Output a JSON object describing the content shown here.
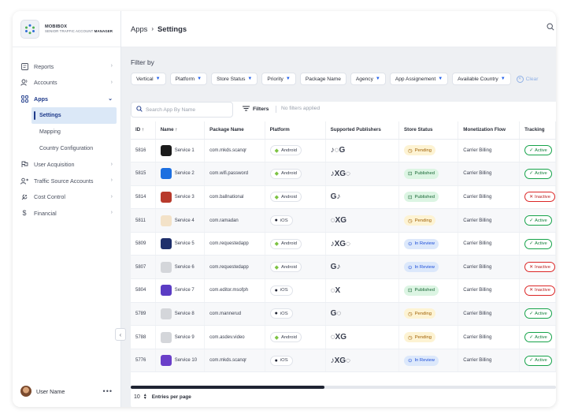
{
  "brand": {
    "name": "MOBIBOX",
    "sub_prefix": "SENIOR TRAFFIC ACCOUNT ",
    "sub_bold": "MANAGER"
  },
  "sidebar": {
    "items": [
      {
        "label": "Reports",
        "icon": "report-icon"
      },
      {
        "label": "Accounts",
        "icon": "users-icon"
      },
      {
        "label": "Apps",
        "icon": "apps-grid-icon"
      },
      {
        "label": "User Acquisition",
        "icon": "acquisition-icon"
      },
      {
        "label": "Traffic Source Accounts",
        "icon": "traffic-icon"
      },
      {
        "label": "Cost Control",
        "icon": "cost-icon"
      },
      {
        "label": "Financial",
        "icon": "dollar-icon"
      }
    ],
    "apps_sub": [
      "Settings",
      "Mapping",
      "Country Configuration"
    ],
    "user": {
      "name": "User Name"
    }
  },
  "breadcrumb": {
    "parent": "Apps",
    "current": "Settings"
  },
  "filter": {
    "title": "Filter by",
    "chips": [
      "Vertical",
      "Platform",
      "Store Status",
      "Priority",
      "Package Name",
      "Agency",
      "App Assignement",
      "Available Country"
    ],
    "clear": "Clear"
  },
  "toolbar": {
    "search_placeholder": "Search App By Name",
    "filters_label": "Filters",
    "no_filters": "No filters applied"
  },
  "table": {
    "columns": [
      "ID",
      "Name",
      "Package Name",
      "Platform",
      "Supported Publishers",
      "Store Status",
      "Monetization Flow",
      "Tracking"
    ],
    "rows": [
      {
        "id": "5816",
        "name": "Service 1",
        "package": "com.mkds.scanqr",
        "platform": "Android",
        "pubs": "♪◌G",
        "status": "Pending",
        "flow": "Carrier Billing",
        "tracking": "Active",
        "icon_color": "#1b1b1b"
      },
      {
        "id": "5815",
        "name": "Service 2",
        "package": "com.wifi.password",
        "platform": "Android",
        "pubs": "♪XG◌",
        "status": "Published",
        "flow": "Carrier Billing",
        "tracking": "Active",
        "icon_color": "#1d6fe0"
      },
      {
        "id": "5814",
        "name": "Service 3",
        "package": "com.ballnational",
        "platform": "Android",
        "pubs": "G♪",
        "status": "Published",
        "flow": "Carrier Billing",
        "tracking": "Inactive",
        "icon_color": "#b83a2c"
      },
      {
        "id": "5811",
        "name": "Service 4",
        "package": "com.ramadan",
        "platform": "iOS",
        "pubs": "◌XG",
        "status": "Pending",
        "flow": "Carrier Billing",
        "tracking": "Active",
        "icon_color": "#f3e2c8"
      },
      {
        "id": "5809",
        "name": "Service 5",
        "package": "com.requestedapp",
        "platform": "Android",
        "pubs": "♪XG◌",
        "status": "In Review",
        "flow": "Carrier Billing",
        "tracking": "Active",
        "icon_color": "#1e2f6b"
      },
      {
        "id": "5807",
        "name": "Service 6",
        "package": "com.requestedapp",
        "platform": "Android",
        "pubs": "G♪",
        "status": "In Review",
        "flow": "Carrier Billing",
        "tracking": "Inactive",
        "icon_color": "#d4d6da"
      },
      {
        "id": "5804",
        "name": "Service 7",
        "package": "com.editor.msofph",
        "platform": "iOS",
        "pubs": "◌X",
        "status": "Published",
        "flow": "Carrier Billing",
        "tracking": "Inactive",
        "icon_color": "#5b3cc4"
      },
      {
        "id": "5789",
        "name": "Service 8",
        "package": "com.mannerud",
        "platform": "iOS",
        "pubs": "G◌",
        "status": "Pending",
        "flow": "Carrier Billing",
        "tracking": "Active",
        "icon_color": "#d4d6da"
      },
      {
        "id": "5788",
        "name": "Service 9",
        "package": "com.asdev.video",
        "platform": "Android",
        "pubs": "◌XG",
        "status": "Pending",
        "flow": "Carrier Billing",
        "tracking": "Active",
        "icon_color": "#d4d6da"
      },
      {
        "id": "5776",
        "name": "Service 10",
        "package": "com.mkds.scanqr",
        "platform": "iOS",
        "pubs": "♪XG◌",
        "status": "In Review",
        "flow": "Carrier Billing",
        "tracking": "Active",
        "icon_color": "#6a3fc9"
      }
    ]
  },
  "pager": {
    "value": "10",
    "label": "Entries per page"
  },
  "colors": {
    "accent": "#1e3a8a",
    "android": "#7cc242",
    "active": "#16a34a",
    "inactive": "#dc2626"
  }
}
